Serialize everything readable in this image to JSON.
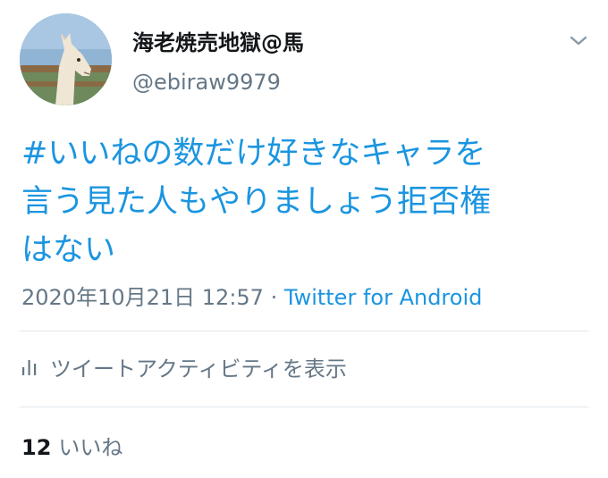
{
  "user": {
    "display_name": "海老焼売地獄@馬",
    "handle": "@ebiraw9979",
    "avatar_icon": "horse-avatar"
  },
  "tweet": {
    "text_lines": [
      "#いいねの数だけ好きなキャラを",
      "言う見た人もやりましょう拒否権",
      "はない"
    ],
    "timestamp": "2020年10月21日 12:57",
    "separator": "·",
    "client": "Twitter for Android"
  },
  "activity": {
    "label": "ツイートアクティビティを表示",
    "icon": "bar-chart-icon"
  },
  "likes": {
    "count": "12",
    "label": "いいね"
  },
  "colors": {
    "link": "#1b95e0",
    "secondary_text": "#657786",
    "primary_text": "#14171a",
    "divider": "#e1e8ed"
  }
}
